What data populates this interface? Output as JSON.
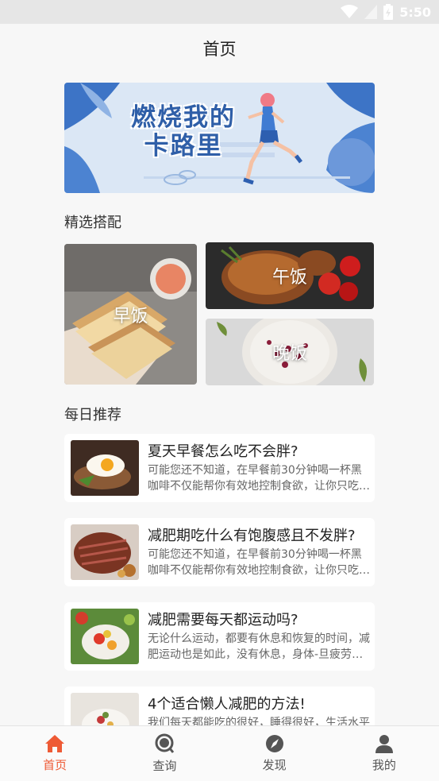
{
  "status_bar": {
    "time": "5:50"
  },
  "header": {
    "title": "首页"
  },
  "banner": {
    "text": "燃烧我的\n卡路里"
  },
  "featured": {
    "title": "精选搭配",
    "tiles": [
      {
        "label": "早饭"
      },
      {
        "label": "午饭"
      },
      {
        "label": "晚饭"
      }
    ]
  },
  "daily": {
    "title": "每日推荐",
    "items": [
      {
        "title": "夏天早餐怎么吃不会胖?",
        "desc": "可能您还不知道，在早餐前30分钟喝一杯黑咖啡不仅能帮你有效地控制食欲，让你只吃一半的早餐"
      },
      {
        "title": "减肥期吃什么有饱腹感且不发胖?",
        "desc": "可能您还不知道，在早餐前30分钟喝一杯黑咖啡不仅能帮你有效地控制食欲，让你只吃一半的早餐"
      },
      {
        "title": "减肥需要每天都运动吗?",
        "desc": "无论什么运动，都要有休息和恢复的时间，减肥运动也是如此，没有休息，身体-旦疲劳，影响情绪"
      },
      {
        "title": "4个适合懒人减肥的方法!",
        "desc": "我们每天都能吃的很好，睡得很好，生活水平提高了"
      }
    ]
  },
  "nav": {
    "items": [
      {
        "label": "首页",
        "icon": "home-icon",
        "active": true
      },
      {
        "label": "查询",
        "icon": "search-icon",
        "active": false
      },
      {
        "label": "发现",
        "icon": "compass-icon",
        "active": false
      },
      {
        "label": "我的",
        "icon": "user-icon",
        "active": false
      }
    ],
    "active_color": "#ee5a35",
    "inactive_color": "#555555"
  }
}
